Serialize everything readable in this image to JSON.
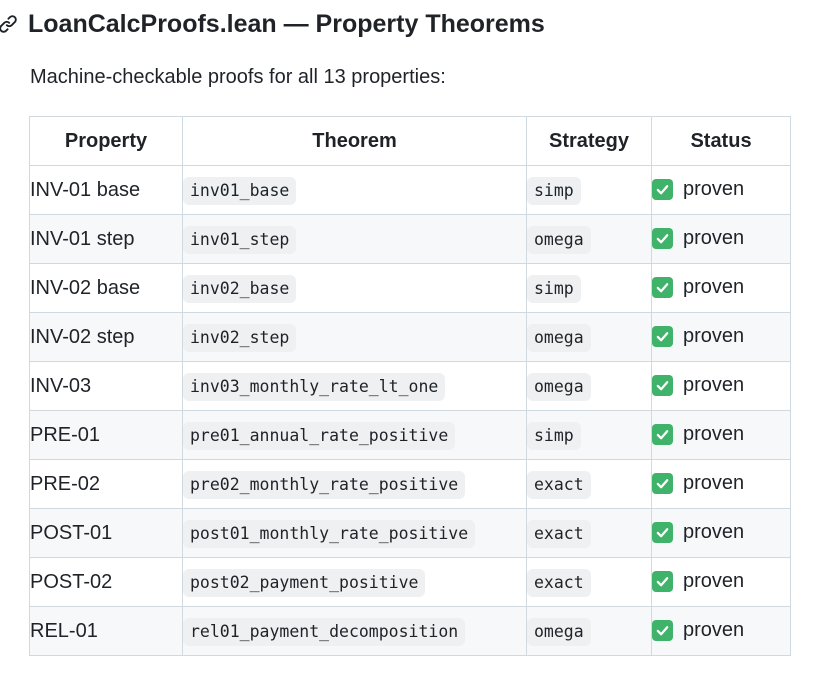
{
  "heading": {
    "title": "LoanCalcProofs.lean — Property Theorems",
    "anchor_icon": "link-icon"
  },
  "intro": "Machine-checkable proofs for all 13 properties:",
  "table": {
    "headers": [
      "Property",
      "Theorem",
      "Strategy",
      "Status"
    ],
    "status_icon": "checkmark-icon",
    "status_color": "#40b36b",
    "rows": [
      {
        "property": "INV-01 base",
        "theorem": "inv01_base",
        "strategy": "simp",
        "status": "proven"
      },
      {
        "property": "INV-01 step",
        "theorem": "inv01_step",
        "strategy": "omega",
        "status": "proven"
      },
      {
        "property": "INV-02 base",
        "theorem": "inv02_base",
        "strategy": "simp",
        "status": "proven"
      },
      {
        "property": "INV-02 step",
        "theorem": "inv02_step",
        "strategy": "omega",
        "status": "proven"
      },
      {
        "property": "INV-03",
        "theorem": "inv03_monthly_rate_lt_one",
        "strategy": "omega",
        "status": "proven"
      },
      {
        "property": "PRE-01",
        "theorem": "pre01_annual_rate_positive",
        "strategy": "simp",
        "status": "proven"
      },
      {
        "property": "PRE-02",
        "theorem": "pre02_monthly_rate_positive",
        "strategy": "exact",
        "status": "proven"
      },
      {
        "property": "POST-01",
        "theorem": "post01_monthly_rate_positive",
        "strategy": "exact",
        "status": "proven"
      },
      {
        "property": "POST-02",
        "theorem": "post02_payment_positive",
        "strategy": "exact",
        "status": "proven"
      },
      {
        "property": "REL-01",
        "theorem": "rel01_payment_decomposition",
        "strategy": "omega",
        "status": "proven"
      }
    ]
  }
}
